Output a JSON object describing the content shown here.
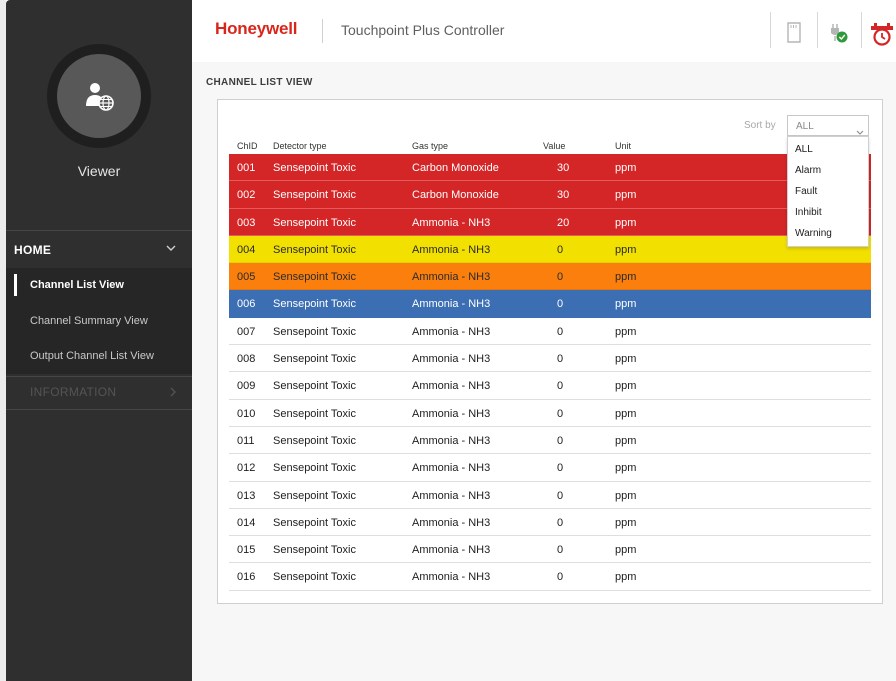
{
  "sidebar": {
    "role": "Viewer",
    "home_label": "HOME",
    "items": [
      {
        "label": "Channel List View",
        "active": true
      },
      {
        "label": "Channel Summary View",
        "active": false
      },
      {
        "label": "Output Channel List View",
        "active": false
      }
    ],
    "information_label": "INFORMATION"
  },
  "header": {
    "brand": "Honeywell",
    "app_title": "Touchpoint Plus Controller",
    "icons": [
      "sd-card-icon",
      "power-ok-icon",
      "alarm-clock-icon"
    ]
  },
  "page": {
    "title": "CHANNEL LIST VIEW"
  },
  "sort": {
    "label": "Sort by",
    "selected": "ALL",
    "options": [
      "ALL",
      "Alarm",
      "Fault",
      "Inhibit",
      "Warning"
    ]
  },
  "table": {
    "columns": [
      "ChID",
      "Detector type",
      "Gas type",
      "Value",
      "Unit"
    ],
    "status_colors": {
      "alarm": "#d42527",
      "warning": "#f2e000",
      "fault": "#fb7f0d",
      "inhibit": "#3b6eb3"
    },
    "rows": [
      {
        "id": "001",
        "detector": "Sensepoint Toxic",
        "gas": "Carbon Monoxide",
        "value": "30",
        "unit": "ppm",
        "status": "alarm"
      },
      {
        "id": "002",
        "detector": "Sensepoint Toxic",
        "gas": "Carbon Monoxide",
        "value": "30",
        "unit": "ppm",
        "status": "alarm"
      },
      {
        "id": "003",
        "detector": "Sensepoint Toxic",
        "gas": "Ammonia - NH3",
        "value": "20",
        "unit": "ppm",
        "status": "alarm"
      },
      {
        "id": "004",
        "detector": "Sensepoint Toxic",
        "gas": "Ammonia - NH3",
        "value": "0",
        "unit": "ppm",
        "status": "warning"
      },
      {
        "id": "005",
        "detector": "Sensepoint Toxic",
        "gas": "Ammonia - NH3",
        "value": "0",
        "unit": "ppm",
        "status": "fault"
      },
      {
        "id": "006",
        "detector": "Sensepoint Toxic",
        "gas": "Ammonia - NH3",
        "value": "0",
        "unit": "ppm",
        "status": "inhibit"
      },
      {
        "id": "007",
        "detector": "Sensepoint Toxic",
        "gas": "Ammonia - NH3",
        "value": "0",
        "unit": "ppm",
        "status": "normal"
      },
      {
        "id": "008",
        "detector": "Sensepoint Toxic",
        "gas": "Ammonia - NH3",
        "value": "0",
        "unit": "ppm",
        "status": "normal"
      },
      {
        "id": "009",
        "detector": "Sensepoint Toxic",
        "gas": "Ammonia - NH3",
        "value": "0",
        "unit": "ppm",
        "status": "normal"
      },
      {
        "id": "010",
        "detector": "Sensepoint Toxic",
        "gas": "Ammonia - NH3",
        "value": "0",
        "unit": "ppm",
        "status": "normal"
      },
      {
        "id": "011",
        "detector": "Sensepoint Toxic",
        "gas": "Ammonia - NH3",
        "value": "0",
        "unit": "ppm",
        "status": "normal"
      },
      {
        "id": "012",
        "detector": "Sensepoint Toxic",
        "gas": "Ammonia - NH3",
        "value": "0",
        "unit": "ppm",
        "status": "normal"
      },
      {
        "id": "013",
        "detector": "Sensepoint Toxic",
        "gas": "Ammonia - NH3",
        "value": "0",
        "unit": "ppm",
        "status": "normal"
      },
      {
        "id": "014",
        "detector": "Sensepoint Toxic",
        "gas": "Ammonia - NH3",
        "value": "0",
        "unit": "ppm",
        "status": "normal"
      },
      {
        "id": "015",
        "detector": "Sensepoint Toxic",
        "gas": "Ammonia - NH3",
        "value": "0",
        "unit": "ppm",
        "status": "normal"
      },
      {
        "id": "016",
        "detector": "Sensepoint Toxic",
        "gas": "Ammonia - NH3",
        "value": "0",
        "unit": "ppm",
        "status": "normal"
      }
    ]
  }
}
